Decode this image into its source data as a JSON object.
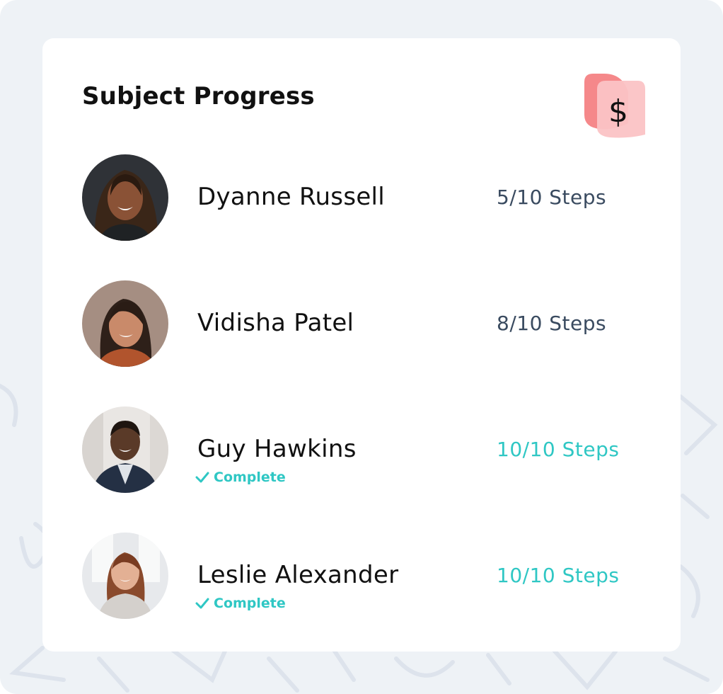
{
  "card": {
    "title": "Subject Progress",
    "header_icon": "dollar-icon"
  },
  "colors": {
    "background": "#eef2f6",
    "card": "#ffffff",
    "accent_complete": "#2fc7c4",
    "steps_text": "#3a4b60",
    "icon_coral": "#f5888a",
    "icon_pink": "#fbc3c5"
  },
  "subjects": [
    {
      "name": "Dyanne Russell",
      "steps": "5/10 Steps",
      "completed": 5,
      "total": 10,
      "status": ""
    },
    {
      "name": "Vidisha Patel",
      "steps": "8/10 Steps",
      "completed": 8,
      "total": 10,
      "status": ""
    },
    {
      "name": "Guy Hawkins",
      "steps": "10/10 Steps",
      "completed": 10,
      "total": 10,
      "status": "Complete",
      "status_icon": "check-icon"
    },
    {
      "name": "Leslie Alexander",
      "steps": "10/10 Steps",
      "completed": 10,
      "total": 10,
      "status": "Complete",
      "status_icon": "check-icon"
    }
  ]
}
